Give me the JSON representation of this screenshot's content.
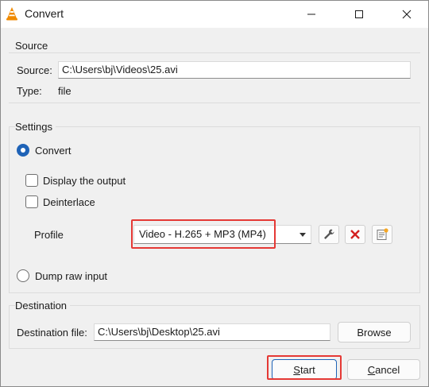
{
  "window": {
    "title": "Convert",
    "minimize_icon": "minimize-icon",
    "maximize_icon": "maximize-icon",
    "close_icon": "close-icon"
  },
  "source": {
    "group_title": "Source",
    "source_label": "Source:",
    "source_value": "C:\\Users\\bj\\Videos\\25.avi",
    "type_label": "Type:",
    "type_value": "file"
  },
  "settings": {
    "group_title": "Settings",
    "convert_label": "Convert",
    "convert_checked": true,
    "display_output_label": "Display the output",
    "display_output_checked": false,
    "deinterlace_label": "Deinterlace",
    "deinterlace_checked": false,
    "profile_label": "Profile",
    "profile_value": "Video - H.265 + MP3 (MP4)",
    "edit_profile_icon": "wrench-icon",
    "delete_profile_icon": "red-x-icon",
    "new_profile_icon": "new-profile-icon",
    "dump_raw_label": "Dump raw input",
    "dump_raw_checked": false
  },
  "destination": {
    "group_title": "Destination",
    "file_label": "Destination file:",
    "file_value": "C:\\Users\\bj\\Desktop\\25.avi",
    "browse_label": "Browse"
  },
  "footer": {
    "start_label_underlined": "S",
    "start_label_rest": "tart",
    "cancel_label_underlined": "C",
    "cancel_label_rest": "ancel"
  },
  "colors": {
    "highlight": "#e53935",
    "accent": "#1f63b7",
    "background": "#f0f0f0"
  }
}
